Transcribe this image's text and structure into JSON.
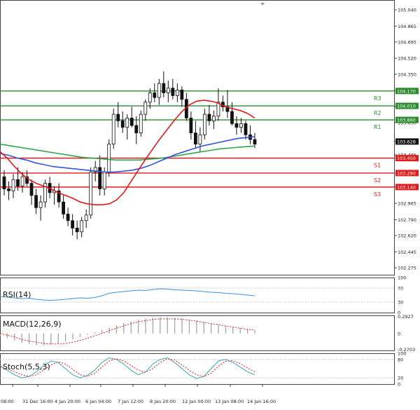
{
  "chart_data": [
    {
      "type": "candlestick",
      "panel": "price",
      "ylim": [
        102.2,
        105.1
      ],
      "y_ticks": [
        "105.040",
        "104.865",
        "104.695",
        "104.520",
        "104.350",
        "104.175",
        "104.005",
        "103.830",
        "103.628",
        "103.485",
        "103.140",
        "102.965",
        "102.790",
        "102.620",
        "102.445",
        "102.275"
      ],
      "last_price": "103.628",
      "levels": [
        {
          "name": "R3",
          "value": 104.17,
          "label": "104.170",
          "color": "#2e8b2e"
        },
        {
          "name": "R2",
          "value": 104.01,
          "label": "104.010",
          "color": "#2e8b2e"
        },
        {
          "name": "R1",
          "value": 103.86,
          "label": "103.860",
          "color": "#2e8b2e"
        },
        {
          "name": "S1",
          "value": 103.45,
          "label": "103.450",
          "color": "#e01b1b"
        },
        {
          "name": "S2",
          "value": 103.29,
          "label": "103.290",
          "color": "#e01b1b"
        },
        {
          "name": "S3",
          "value": 103.14,
          "label": "103.140",
          "color": "#e01b1b"
        }
      ],
      "candles": [
        [
          103.25,
          103.32,
          103.05,
          103.12
        ],
        [
          103.12,
          103.2,
          103.0,
          103.1
        ],
        [
          103.1,
          103.28,
          103.02,
          103.22
        ],
        [
          103.22,
          103.35,
          103.1,
          103.15
        ],
        [
          103.15,
          103.3,
          103.08,
          103.25
        ],
        [
          103.25,
          103.32,
          103.15,
          103.18
        ],
        [
          103.18,
          103.22,
          102.95,
          103.05
        ],
        [
          103.05,
          103.12,
          102.85,
          102.92
        ],
        [
          102.92,
          103.05,
          102.78,
          102.98
        ],
        [
          102.98,
          103.22,
          102.92,
          103.18
        ],
        [
          103.18,
          103.25,
          103.02,
          103.08
        ],
        [
          103.08,
          103.15,
          102.95,
          103.1
        ],
        [
          103.1,
          103.18,
          102.92,
          102.98
        ],
        [
          102.98,
          103.05,
          102.8,
          102.85
        ],
        [
          102.85,
          102.92,
          102.72,
          102.78
        ],
        [
          102.78,
          102.85,
          102.62,
          102.7
        ],
        [
          102.7,
          102.78,
          102.58,
          102.66
        ],
        [
          102.66,
          102.82,
          102.6,
          102.78
        ],
        [
          102.78,
          102.9,
          102.7,
          102.84
        ],
        [
          102.84,
          103.35,
          102.8,
          103.3
        ],
        [
          103.3,
          103.42,
          103.2,
          103.35
        ],
        [
          103.35,
          103.48,
          103.05,
          103.12
        ],
        [
          103.12,
          103.35,
          103.05,
          103.3
        ],
        [
          103.3,
          103.65,
          103.25,
          103.6
        ],
        [
          103.6,
          103.98,
          103.55,
          103.92
        ],
        [
          103.92,
          104.05,
          103.78,
          103.85
        ],
        [
          103.85,
          103.95,
          103.72,
          103.78
        ],
        [
          103.78,
          103.92,
          103.65,
          103.88
        ],
        [
          103.88,
          104.0,
          103.78,
          103.8
        ],
        [
          103.8,
          103.9,
          103.6,
          103.72
        ],
        [
          103.72,
          103.96,
          103.68,
          103.92
        ],
        [
          103.92,
          104.08,
          103.85,
          104.05
        ],
        [
          104.05,
          104.2,
          103.98,
          104.15
        ],
        [
          104.15,
          104.25,
          104.05,
          104.1
        ],
        [
          104.1,
          104.3,
          104.02,
          104.25
        ],
        [
          104.25,
          104.38,
          104.1,
          104.15
        ],
        [
          104.15,
          104.28,
          104.05,
          104.2
        ],
        [
          104.2,
          104.3,
          104.08,
          104.12
        ],
        [
          104.12,
          104.25,
          104.05,
          104.18
        ],
        [
          104.18,
          104.22,
          104.0,
          104.08
        ],
        [
          104.08,
          104.15,
          103.85,
          103.88
        ],
        [
          103.88,
          103.95,
          103.65,
          103.72
        ],
        [
          103.72,
          103.85,
          103.55,
          103.6
        ],
        [
          103.6,
          103.78,
          103.52,
          103.7
        ],
        [
          103.7,
          103.98,
          103.65,
          103.92
        ],
        [
          103.92,
          104.02,
          103.8,
          103.85
        ],
        [
          103.85,
          103.96,
          103.76,
          103.9
        ],
        [
          103.9,
          104.2,
          103.85,
          104.05
        ],
        [
          104.05,
          104.12,
          103.95,
          104.0
        ],
        [
          104.0,
          104.18,
          103.88,
          103.95
        ],
        [
          103.95,
          104.05,
          103.8,
          103.82
        ],
        [
          103.82,
          103.9,
          103.7,
          103.78
        ],
        [
          103.78,
          103.88,
          103.72,
          103.82
        ],
        [
          103.82,
          103.85,
          103.65,
          103.7
        ],
        [
          103.7,
          103.8,
          103.6,
          103.65
        ],
        [
          103.65,
          103.72,
          103.56,
          103.6
        ]
      ],
      "sma_fast": [
        103.52,
        103.45,
        103.36,
        103.28,
        103.22,
        103.18,
        103.15,
        103.12,
        103.08,
        103.05,
        103.02,
        102.98,
        102.96,
        102.95,
        102.95,
        102.96,
        103.0,
        103.08,
        103.2,
        103.32,
        103.44,
        103.55,
        103.66,
        103.76,
        103.86,
        103.95,
        104.02,
        104.06,
        104.07,
        104.06,
        104.04,
        104.0,
        103.98,
        103.96,
        103.93,
        103.88
      ],
      "sma_mid": [
        103.5,
        103.48,
        103.45,
        103.43,
        103.4,
        103.38,
        103.36,
        103.35,
        103.34,
        103.33,
        103.32,
        103.31,
        103.3,
        103.3,
        103.31,
        103.32,
        103.34,
        103.37,
        103.41,
        103.45,
        103.49,
        103.52,
        103.55,
        103.58,
        103.6,
        103.62,
        103.64,
        103.66,
        103.67,
        103.68
      ],
      "sma_slow": [
        103.6,
        103.58,
        103.56,
        103.54,
        103.52,
        103.5,
        103.48,
        103.46,
        103.45,
        103.44,
        103.43,
        103.43,
        103.43,
        103.44,
        103.45,
        103.47,
        103.49,
        103.51,
        103.53,
        103.55,
        103.56,
        103.57,
        103.58
      ],
      "x_labels": [
        "08:00",
        "31 Dec 16:00",
        "4 Jan 20:00",
        "6 Jan 04:00",
        "7 Jan 12:00",
        "8 Jan 20:00",
        "12 Jan 00:00",
        "13 Jan 08:00",
        "14 Jan 16:00"
      ]
    },
    {
      "type": "line",
      "panel": "rsi",
      "title": "RSI(14)",
      "ylim": [
        0,
        100
      ],
      "y_ticks": [
        "100",
        "70",
        "30",
        "0"
      ],
      "values": [
        46,
        44,
        42,
        40,
        41,
        38,
        36,
        35,
        36,
        38,
        40,
        42,
        41,
        43,
        48,
        55,
        58,
        60,
        62,
        64,
        63,
        66,
        68,
        67,
        65,
        64,
        63,
        62,
        60,
        58,
        57,
        55,
        54,
        52,
        50,
        48
      ]
    },
    {
      "type": "bar",
      "panel": "macd",
      "title": "MACD(12,26,9)",
      "ylim": [
        -0.29,
        0.31
      ],
      "y_ticks": [
        "0.2927",
        "0",
        "-0.2703"
      ],
      "values": [
        -0.05,
        -0.08,
        -0.12,
        -0.16,
        -0.18,
        -0.2,
        -0.2,
        -0.19,
        -0.17,
        -0.14,
        -0.1,
        -0.06,
        -0.02,
        0.02,
        0.06,
        0.1,
        0.14,
        0.18,
        0.21,
        0.24,
        0.26,
        0.27,
        0.28,
        0.28,
        0.27,
        0.26,
        0.24,
        0.22,
        0.2,
        0.17,
        0.15,
        0.13,
        0.11,
        0.09,
        0.07,
        0.06
      ],
      "signal": [
        0.0,
        -0.03,
        -0.06,
        -0.1,
        -0.13,
        -0.15,
        -0.17,
        -0.18,
        -0.18,
        -0.17,
        -0.15,
        -0.12,
        -0.08,
        -0.04,
        0.0,
        0.05,
        0.09,
        0.13,
        0.17,
        0.2,
        0.22,
        0.24,
        0.25,
        0.25,
        0.25,
        0.24,
        0.23,
        0.21,
        0.19,
        0.17,
        0.15,
        0.13,
        0.11,
        0.09,
        0.07,
        0.06
      ]
    },
    {
      "type": "line",
      "panel": "stoch",
      "title": "Stoch(5,5,3)",
      "ylim": [
        0,
        100
      ],
      "y_ticks": [
        "100",
        "80",
        "20",
        "0"
      ],
      "values": [
        60,
        45,
        30,
        20,
        25,
        40,
        60,
        75,
        70,
        50,
        30,
        20,
        28,
        45,
        70,
        85,
        80,
        65,
        45,
        30,
        40,
        65,
        80,
        85,
        70,
        50,
        30,
        18,
        25,
        50,
        75,
        80,
        70,
        55,
        40,
        30
      ],
      "signal": [
        55,
        50,
        40,
        30,
        25,
        30,
        45,
        62,
        72,
        65,
        48,
        30,
        25,
        35,
        55,
        75,
        82,
        75,
        60,
        45,
        38,
        50,
        70,
        82,
        78,
        62,
        45,
        30,
        24,
        35,
        58,
        74,
        76,
        66,
        52,
        40
      ]
    }
  ]
}
